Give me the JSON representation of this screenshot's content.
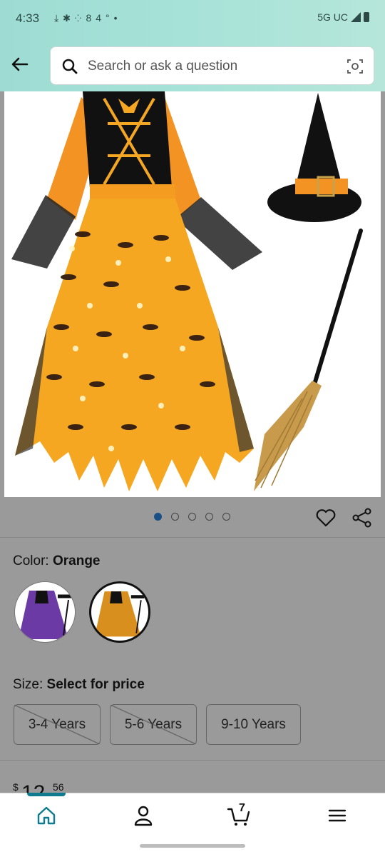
{
  "status_bar": {
    "time": "4:33",
    "temperature": "84°",
    "network": "5G UC"
  },
  "search": {
    "placeholder": "Search or ask a question"
  },
  "carousel": {
    "count": 5,
    "active_index": 0
  },
  "color": {
    "label": "Color: ",
    "value": "Orange",
    "options": [
      "Purple",
      "Orange"
    ],
    "selected": "Orange"
  },
  "size": {
    "label": "Size: ",
    "value": "Select for price",
    "options": [
      {
        "label": "3-4 Years",
        "available": false
      },
      {
        "label": "5-6 Years",
        "available": false
      },
      {
        "label": "9-10 Years",
        "available": true
      }
    ]
  },
  "price": {
    "currency": "$",
    "whole": "12",
    "cents": "56"
  },
  "bottom_nav": {
    "cart_count": "7",
    "items": [
      "home-icon",
      "account-icon",
      "cart-icon",
      "menu-icon"
    ]
  },
  "colors": {
    "accent": "#0f7b8e",
    "header_bg": "#a7e2d8",
    "dress_orange": "#f59a1a"
  }
}
